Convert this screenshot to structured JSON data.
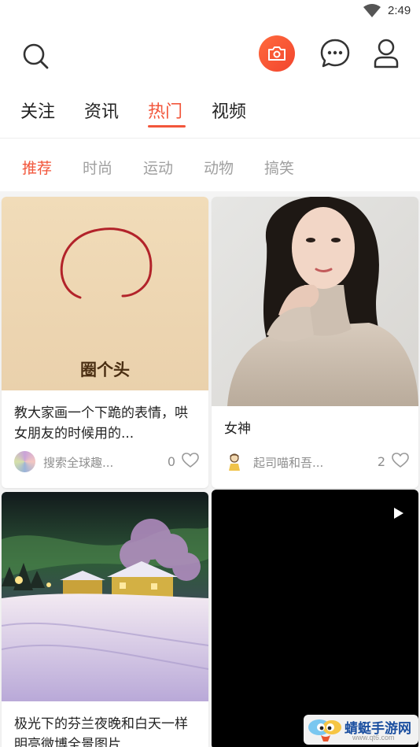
{
  "status_bar": {
    "time": "2:49"
  },
  "main_tabs": [
    {
      "label": "关注"
    },
    {
      "label": "资讯"
    },
    {
      "label": "热门",
      "active": true
    },
    {
      "label": "视频"
    }
  ],
  "sub_tabs": [
    {
      "label": "推荐",
      "active": true
    },
    {
      "label": "时尚"
    },
    {
      "label": "运动"
    },
    {
      "label": "动物"
    },
    {
      "label": "搞笑"
    }
  ],
  "feed": [
    {
      "title": "教大家画一个下跪的表情，哄女朋友的时候用的...",
      "image_caption": "圈个头",
      "author": "搜索全球趣...",
      "likes": "0"
    },
    {
      "title": "女神",
      "author": "起司喵和吾...",
      "likes": "2"
    },
    {
      "title": "极光下的芬兰夜晚和白天一样明亮微博全景图片"
    },
    {
      "type": "video"
    }
  ],
  "watermark": {
    "text": "蜻蜓手游网",
    "url": "www.qt6.com"
  },
  "colors": {
    "accent": "#f2563b",
    "inactive_text": "#a0a0a0",
    "feed_bg": "#f4f4f4"
  },
  "icons": [
    "wifi-icon",
    "search-icon",
    "camera-icon",
    "message-icon",
    "user-icon",
    "heart-icon",
    "play-icon"
  ]
}
